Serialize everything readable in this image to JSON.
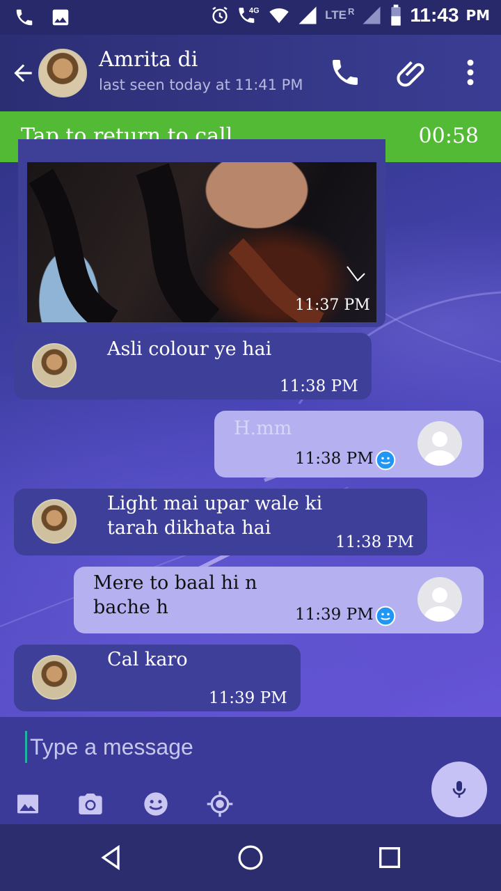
{
  "status_bar": {
    "time": "11:43",
    "ampm": "PM",
    "network": "LTE",
    "roaming": "R",
    "data": "4G"
  },
  "header": {
    "contact_name": "Amrita di",
    "last_seen": "last seen today at 11:41 PM",
    "icons": [
      "back-arrow-icon",
      "phone-icon",
      "attachment-icon",
      "more-vert-icon"
    ]
  },
  "call_banner": {
    "text": "Tap to return to call",
    "timer": "00:58"
  },
  "messages": [
    {
      "type": "image",
      "direction": "in",
      "time": "11:37 PM"
    },
    {
      "type": "text",
      "direction": "in",
      "text": "Asli colour ye hai",
      "time": "11:38 PM"
    },
    {
      "type": "text",
      "direction": "out",
      "text": "H.mm",
      "time": "11:38 PM",
      "status": "delivered"
    },
    {
      "type": "text",
      "direction": "in",
      "text": "Light mai upar wale ki tarah dikhata hai",
      "time": "11:38 PM"
    },
    {
      "type": "text",
      "direction": "out",
      "text": "Mere to baal hi n bache h",
      "time": "11:39 PM",
      "status": "delivered"
    },
    {
      "type": "text",
      "direction": "in",
      "text": "Cal karo",
      "time": "11:39 PM"
    }
  ],
  "composer": {
    "placeholder": "Type a message",
    "tools": [
      "gallery-icon",
      "camera-icon",
      "emoji-icon",
      "location-icon"
    ],
    "mic": "mic-icon"
  },
  "nav": [
    "back-nav-icon",
    "home-nav-icon",
    "recents-nav-icon"
  ],
  "colors": {
    "call_green": "#52ba35",
    "out_bubble": "#b5b0f0",
    "in_bubble": "#3e3f98",
    "accent_blue": "#2196f3"
  }
}
